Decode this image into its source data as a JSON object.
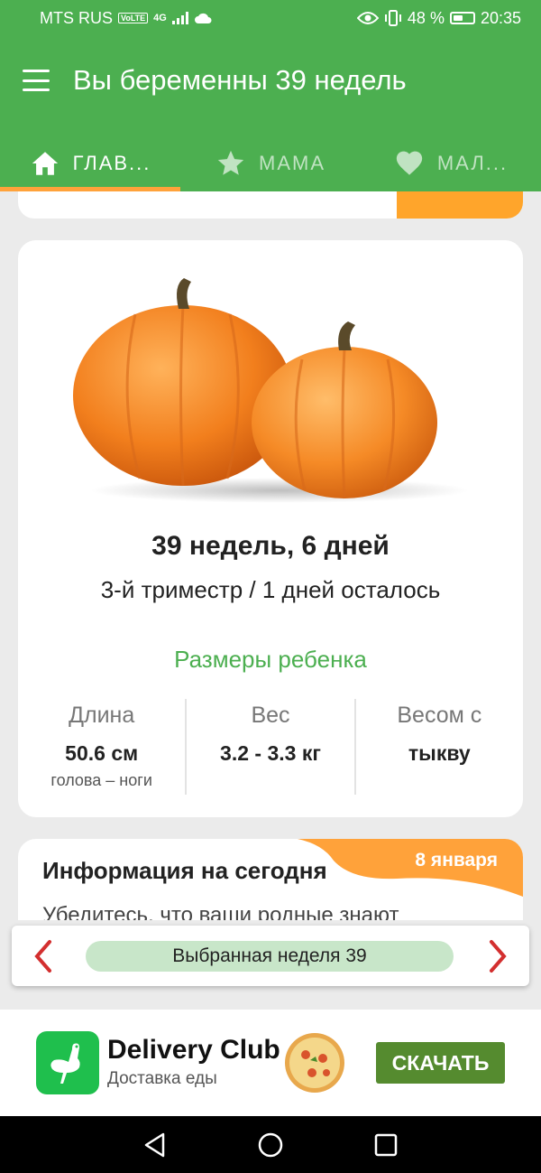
{
  "status_bar": {
    "carrier": "MTS RUS",
    "volte": "VoLTE",
    "network": "4G",
    "battery": "48 %",
    "battery_level": 0.48,
    "time": "20:35"
  },
  "header": {
    "title": "Вы беременны 39 недель",
    "tabs": [
      {
        "label": "ГЛАВ...",
        "icon": "home-icon",
        "active": true
      },
      {
        "label": "МАМА",
        "icon": "star-icon",
        "active": false
      },
      {
        "label": "МАЛ...",
        "icon": "heart-icon",
        "active": false
      }
    ]
  },
  "main_card": {
    "image": "pumpkins",
    "week_title": "39 недель, 6 дней",
    "subtitle": "3-й триместр / 1 дней осталось",
    "sizes_title": "Размеры ребенка",
    "stats": [
      {
        "label": "Длина",
        "value": "50.6 см",
        "note": "голова – ноги"
      },
      {
        "label": "Вес",
        "value": "3.2 - 3.3 кг",
        "note": ""
      },
      {
        "label": "Весом с",
        "value": "тыкву",
        "note": ""
      }
    ]
  },
  "info_card": {
    "title": "Информация на сегодня",
    "date": "8 января",
    "text": "Убедитесь, что ваши родные знают"
  },
  "week_selector": {
    "label": "Выбранная неделя 39"
  },
  "ad": {
    "title": "Delivery Club",
    "subtitle": "Доставка еды",
    "button": "СКАЧАТЬ"
  },
  "colors": {
    "primary": "#4caf50",
    "accent": "#ffa23a",
    "selector_pill": "#c8e6c9",
    "arrows": "#d32f2f",
    "ad_button": "#558b2f"
  }
}
